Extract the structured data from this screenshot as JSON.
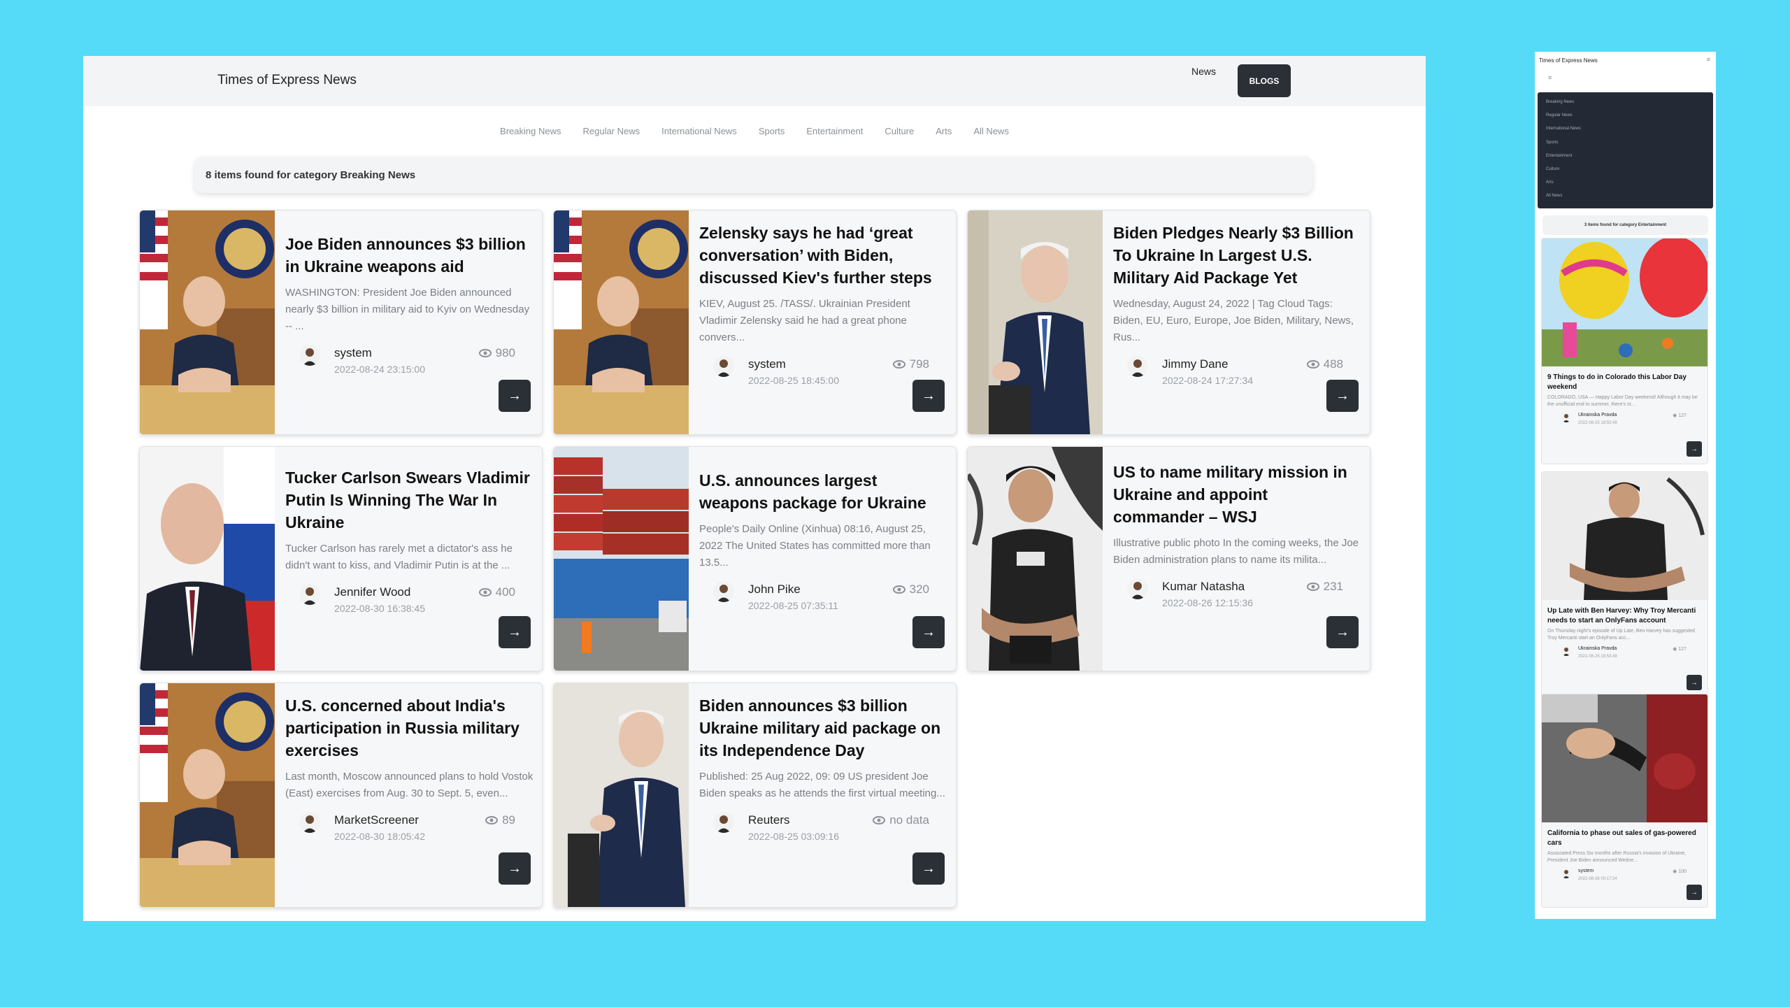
{
  "desktop": {
    "brand": "Times of Express News",
    "nav": {
      "news": "News",
      "blogs": "BLOGS"
    },
    "categories": [
      "Breaking News",
      "Regular News",
      "International News",
      "Sports",
      "Entertainment",
      "Culture",
      "Arts",
      "All News"
    ],
    "found": "8 items found for category Breaking News",
    "articles": [
      {
        "title": "Joe Biden announces $3 billion in Ukraine weapons aid",
        "excerpt": "WASHINGTON: President Joe Biden announced nearly $3 billion in military aid to Kyiv on Wednesday -- ...",
        "author": "system",
        "views": "980",
        "date": "2022-08-24 23:15:00",
        "image": "biden-desk-photo"
      },
      {
        "title": "Zelensky says he had ‘great conversation’ with Biden, discussed Kiev's further steps",
        "excerpt": "KIEV, August 25. /TASS/. Ukrainian President Vladimir Zelensky said he had a great phone convers...",
        "author": "system",
        "views": "798",
        "date": "2022-08-25 18:45:00",
        "image": "biden-desk-photo"
      },
      {
        "title": "Biden Pledges Nearly $3 Billion To Ukraine In Largest U.S. Military Aid Package Yet",
        "excerpt": "Wednesday, August 24, 2022 | Tag Cloud Tags: Biden, EU, Euro, Europe, Joe Biden, Military, News, Rus...",
        "author": "Jimmy Dane",
        "views": "488",
        "date": "2022-08-24 17:27:34",
        "image": "biden-podium-photo"
      },
      {
        "title": "Tucker Carlson Swears Vladimir Putin Is Winning The War In Ukraine",
        "excerpt": "Tucker Carlson has rarely met a dictator's ass he didn't want to kiss, and Vladimir Putin is at the ...",
        "author": "Jennifer Wood",
        "views": "400",
        "date": "2022-08-30 16:38:45",
        "image": "putin-photo"
      },
      {
        "title": "U.S. announces largest weapons package for Ukraine",
        "excerpt": "People's Daily Online (Xinhua) 08:16, August 25, 2022 The United States has committed more than 13.5...",
        "author": "John Pike",
        "views": "320",
        "date": "2022-08-25 07:35:11",
        "image": "containers-photo"
      },
      {
        "title": "US to name military mission in Ukraine and appoint commander – WSJ",
        "excerpt": "Illustrative public photo In the coming weeks, the Joe Biden administration plans to name its milita...",
        "author": "Kumar Natasha",
        "views": "231",
        "date": "2022-08-26 12:15:36",
        "image": "vest-man-photo"
      },
      {
        "title": "U.S. concerned about India's participation in Russia military exercises",
        "excerpt": "Last month, Moscow announced plans to hold Vostok (East) exercises from Aug. 30 to Sept. 5, even...",
        "author": "MarketScreener",
        "views": "89",
        "date": "2022-08-30 18:05:42",
        "image": "biden-desk-photo"
      },
      {
        "title": "Biden announces $3 billion Ukraine military aid package on its Independence Day",
        "excerpt": "Published: 25 Aug 2022, 09: 09 US president Joe Biden speaks as he attends the first virtual meeting...",
        "author": "Reuters",
        "views": "no data",
        "date": "2022-08-25 03:09:16",
        "image": "biden-podium-photo"
      }
    ]
  },
  "mobile": {
    "brand": "Times of Express News",
    "menu_icon": "≡",
    "categories": [
      "Breaking News",
      "Regular News",
      "International News",
      "Sports",
      "Entertainment",
      "Culture",
      "Arts",
      "All News"
    ],
    "found": "3 items found for category Entertainment",
    "articles": [
      {
        "title": "9 Things to do in Colorado this Labor Day weekend",
        "excerpt": "COLORADO, USA — Happy Labor Day weekend! Although it may be the unofficial end to summer, there's st...",
        "author": "Ukrainska Pravda",
        "views": "127",
        "date": "2022-08-25 18:53:49",
        "image": "balloons-photo"
      },
      {
        "title": "Up Late with Ben Harvey: Why Troy Mercanti needs to start an OnlyFans account",
        "excerpt": "On Thursday night's episode of Up Late, Ben Harvey has suggested Troy Mercanti start an OnlyFans acc...",
        "author": "Ukrainska Pravda",
        "views": "127",
        "date": "2022-08-25 18:53:49",
        "image": "vest-man-photo"
      },
      {
        "title": "California to phase out sales of gas-powered cars",
        "excerpt": "Associated Press Six months after Russia's invasion of Ukraine, President Joe Biden announced Wedne...",
        "author": "system",
        "views": "100",
        "date": "2022-08-26 00:17:24",
        "image": "fuel-pump-photo"
      }
    ]
  },
  "colors": {
    "page_bg": "#55dbf7",
    "button": "#2b2f36",
    "topbar": "#f3f4f5"
  }
}
